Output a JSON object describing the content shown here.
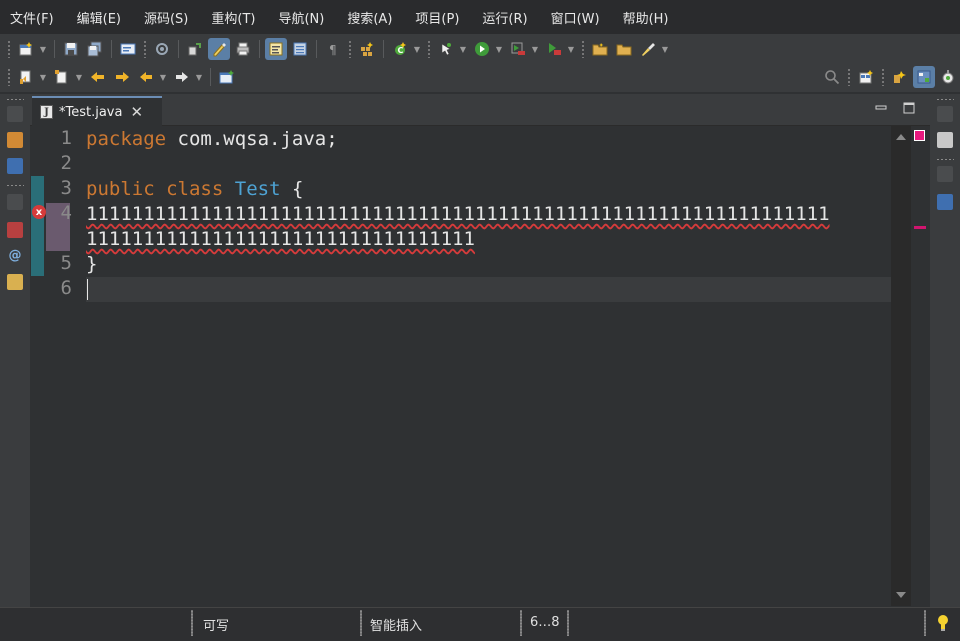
{
  "menu": [
    "文件(F)",
    "编辑(E)",
    "源码(S)",
    "重构(T)",
    "导航(N)",
    "搜索(A)",
    "项目(P)",
    "运行(R)",
    "窗口(W)",
    "帮助(H)"
  ],
  "editor": {
    "tab_label": "*Test.java",
    "tab_close": "✕",
    "line_numbers": [
      "1",
      "2",
      "3",
      "4",
      "5",
      "6"
    ],
    "line1": {
      "keyword": "package",
      "rest": " com.wqsa.java;"
    },
    "line3": {
      "kw1": "public",
      "kw2": "class",
      "class_name": "Test",
      "brace": " {"
    },
    "line4a": "11111111111111111111111111111111111111111111111111111111111111111",
    "line4b": "1111111111111111111111111111111111",
    "line5": "}",
    "error_glyph": "x"
  },
  "status": {
    "writable": "可写",
    "insert_mode": "智能插入",
    "position": "6…8"
  },
  "colors": {
    "keyword": "#cc7832",
    "class_name": "#4ea3d4",
    "error": "#d63b3b",
    "active_tab_border": "#6b8db5"
  },
  "icons": {
    "toolbar1": [
      "new-wizard-icon",
      "save-icon",
      "save-all-icon",
      "console-icon",
      "task-icon",
      "debug-config-icon",
      "highlight-icon",
      "print-icon",
      "toggle-mark-icon",
      "show-whitespace-icon",
      "pilcrow-icon",
      "new-java-package-icon",
      "refresh-icon",
      "breakpoint-icon",
      "run-icon",
      "debug-icon",
      "coverage-icon",
      "open-folder-icon",
      "open-type-icon",
      "brush-icon"
    ],
    "toolbar2": [
      "next-annotation-icon",
      "prev-annotation-icon",
      "last-edit-icon",
      "forward-edit-icon",
      "back-icon",
      "forward-icon",
      "pin-editor-icon",
      "search-icon",
      "open-perspective-icon",
      "java-ee-perspective-icon",
      "java-perspective-icon",
      "debug-perspective-icon"
    ]
  }
}
